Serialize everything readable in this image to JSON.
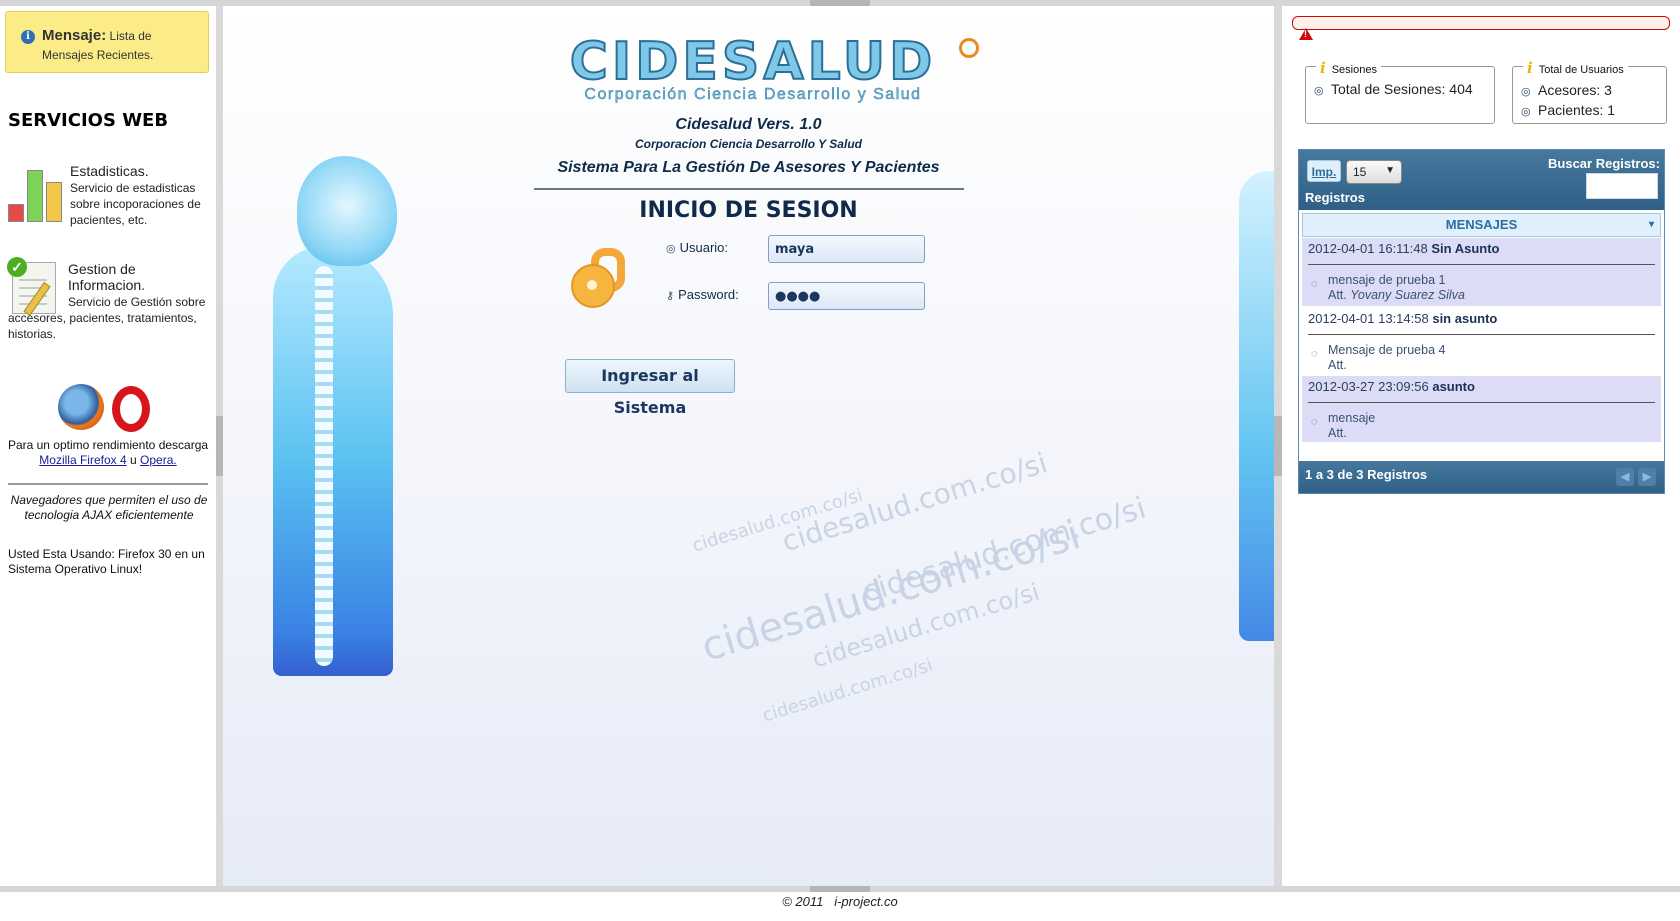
{
  "left": {
    "message_label": "Mensaje:",
    "message_text": "Lista de Mensajes Recientes.",
    "services_title": "SERVICIOS WEB",
    "stats": {
      "name": "Estadisticas.",
      "desc": "Servicio de estadisticas sobre incoporaciones de pacientes, etc."
    },
    "info": {
      "name": "Gestion de Informacion.",
      "desc": "Servicio de Gestión sobre accesores, pacientes, tratamientos, historias."
    },
    "browser_text_1": "Para un optimo rendimiento descarga",
    "firefox_link": "Mozilla Firefox 4",
    "browser_text_2": "u",
    "opera_link": "Opera.",
    "ajax_note": "Navegadores que permiten el uso de tecnologia AJAX eficientemente",
    "using": "Usted Esta Usando: Firefox 30 en un Sistema Operativo Linux!"
  },
  "center": {
    "logo_title": "CIDESALUD",
    "logo_subtitle": "Corporación Ciencia Desarrollo y Salud",
    "version": "Cidesalud Vers. 1.0",
    "corp": "Corporacion Ciencia Desarrollo Y Salud",
    "system_title": "Sistema Para La Gestión De Asesores Y Pacientes",
    "login_title": "INICIO DE SESION",
    "user_label": "Usuario:",
    "user_value": "maya",
    "password_label": "Password:",
    "password_value": "●●●●",
    "login_button": "Ingresar al Sistema",
    "watermark": "cidesalud.com.co/si"
  },
  "right": {
    "sessions": {
      "legend": "Sesiones",
      "total": "Total de Sesiones: 404"
    },
    "users": {
      "legend": "Total de Usuarios",
      "asesores": "Acesores: 3",
      "pacientes": "Pacientes: 1"
    },
    "grid": {
      "imp_button": "Imp.",
      "page_size": "15",
      "search_label": "Buscar Registros:",
      "records_label": "Registros",
      "column": "MENSAJES",
      "messages": [
        {
          "date": "2012-04-01 16:11:48",
          "subject": "Sin Asunto",
          "body": "mensaje de prueba 1",
          "att": "Att.",
          "author": "Yovany Suarez Silva"
        },
        {
          "date": "2012-04-01 13:14:58",
          "subject": "sin asunto",
          "body": "Mensaje de prueba 4",
          "att": "Att.",
          "author": ""
        },
        {
          "date": "2012-03-27 23:09:56",
          "subject": "asunto",
          "body": "mensaje",
          "att": "Att.",
          "author": ""
        }
      ],
      "footer": "1 a 3 de 3 Registros"
    }
  },
  "footer": {
    "copyright": "© 2011",
    "site": "i-project.co"
  },
  "colors": {
    "accent": "#2f5f86",
    "message_bg": "#fbec88",
    "title": "#102a4a",
    "alert": "#cd0a0a"
  }
}
